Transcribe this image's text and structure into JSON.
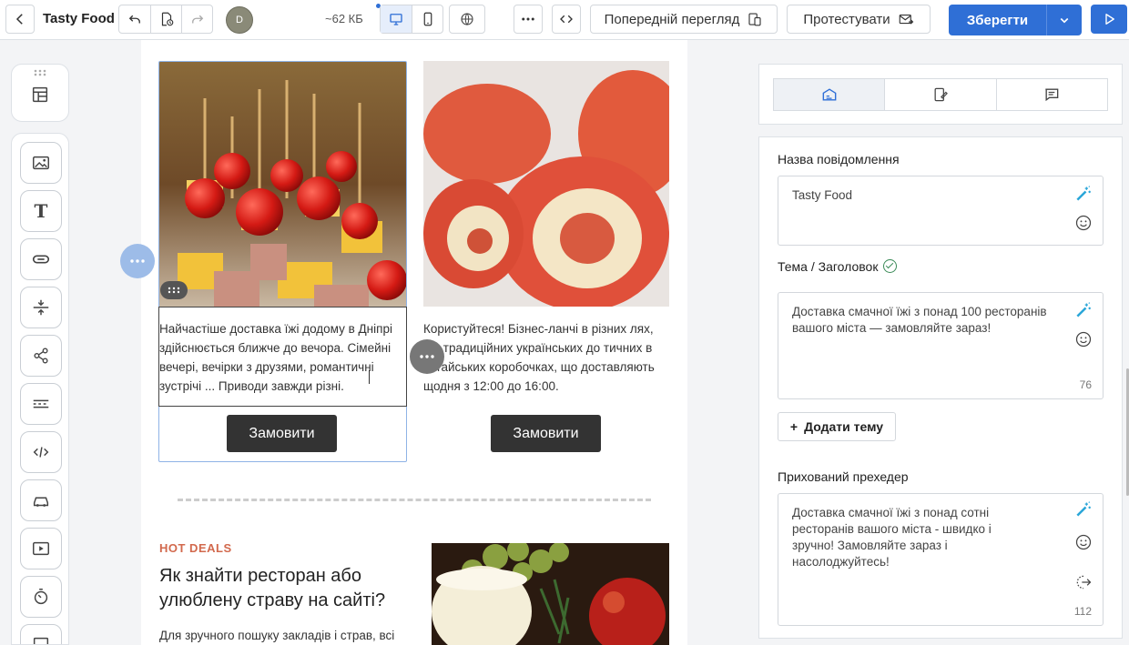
{
  "app": {
    "title": "Tasty Food",
    "avatar_initial": "D",
    "size": "~62 КБ",
    "preview_label": "Попередній перегляд",
    "test_label": "Протестувати",
    "save_label": "Зберегти",
    "accent_color": "#2f6fd6"
  },
  "canvas": {
    "col1_text": "Найчастіше доставка їжі додому в Дніпрі здійснюється ближче до вечора. Сімейні вечері, вечірки з друзями, романтичні зустрічі ... Приводи завжди різні.",
    "col2_text": "Користуйтеся! Бізнес-ланчі в різних    лях, від традиційних українських до    тичних в китайських коробочках, що доставляють щодня з 12:00 до 16:00.",
    "col1_button": "Замовити",
    "col2_button": "Замовити",
    "hot_label": "HOT DEALS",
    "hot_title": "Як знайти ресторан або улюблену страву на сайті?",
    "hot_text": "Для зручного пошуку закладів і страв, всі"
  },
  "panel": {
    "name_label": "Назва повідомлення",
    "name_value": "Tasty Food",
    "subject_label": "Тема / Заголовок",
    "subject_value": "Доставка смачної їжі з понад 100 ресторанів вашого міста — замовляйте зараз!",
    "subject_count": "76",
    "add_subject": "Додати тему",
    "preheader_label": "Прихований прехедер",
    "preheader_value": "Доставка смачної їжі з понад сотні ресторанів вашого міста - швидко і зручно! Замовляйте зараз і насолоджуйтесь!",
    "preheader_count": "112"
  },
  "icons": {
    "back": "chevron-left-icon",
    "undo": "undo-icon",
    "history": "history-file-icon",
    "redo": "redo-icon",
    "desktop": "desktop-icon",
    "mobile": "mobile-icon",
    "globe": "globe-icon",
    "more": "more-dots-icon",
    "code": "code-icon",
    "ai": "magic-wand-icon",
    "emoji": "emoji-icon"
  }
}
